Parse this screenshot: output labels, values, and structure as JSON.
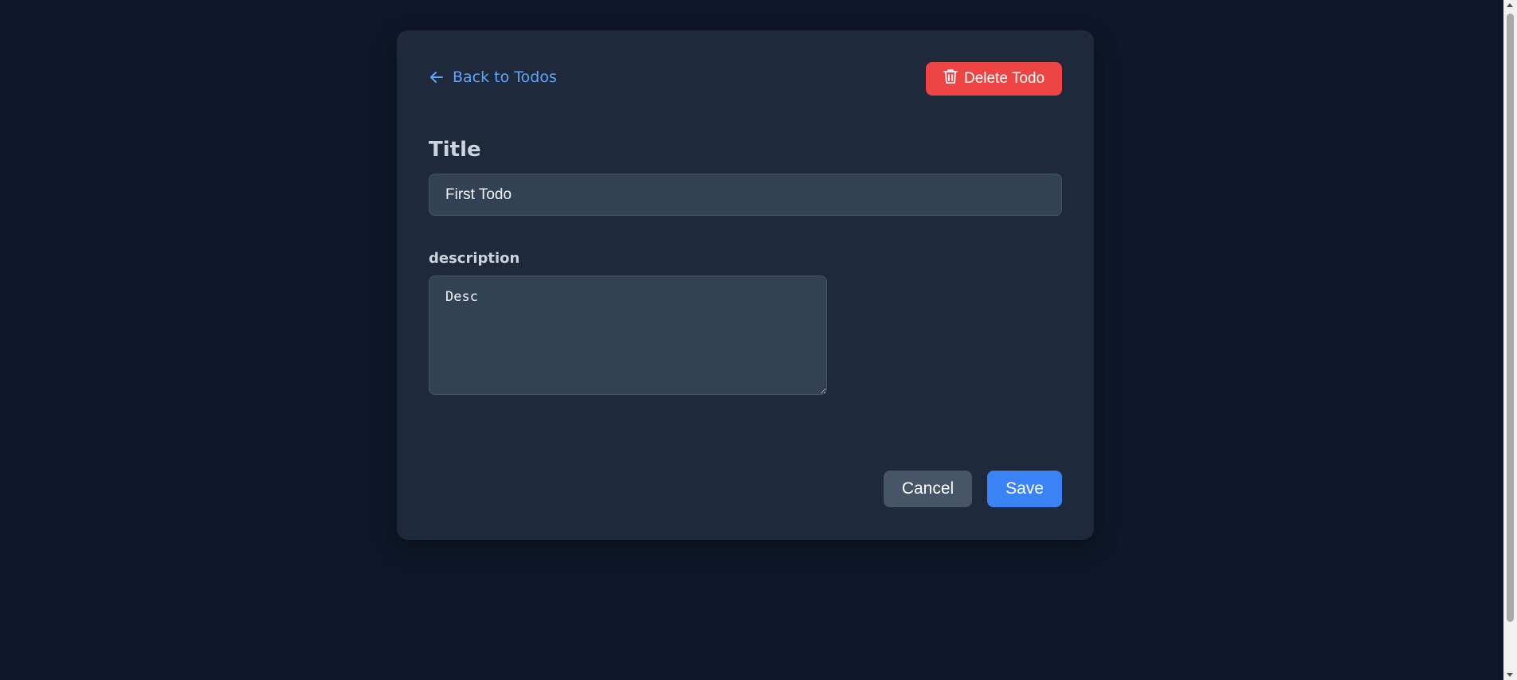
{
  "colors": {
    "page_background": "#0f172a",
    "card_background": "#1e293b",
    "link": "#60a5fa",
    "danger": "#ef4444",
    "primary": "#3b82f6",
    "secondary": "#475569",
    "input_background": "#334155"
  },
  "header": {
    "back_icon": "arrow-left-icon",
    "back_label": "Back to Todos",
    "delete_icon": "trash-icon",
    "delete_label": "Delete Todo"
  },
  "form": {
    "title_label": "Title",
    "title_value": "First Todo",
    "description_label": "description",
    "description_value": "Desc"
  },
  "actions": {
    "cancel_label": "Cancel",
    "save_label": "Save"
  }
}
